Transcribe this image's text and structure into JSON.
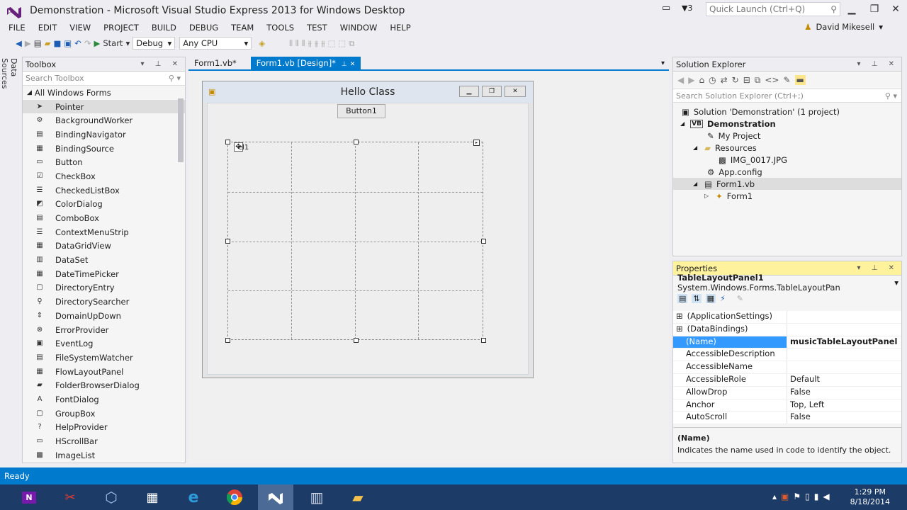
{
  "window": {
    "title": "Demonstration - Microsoft Visual Studio Express 2013 for Windows Desktop",
    "notif_count": "3",
    "quick_launch_placeholder": "Quick Launch (Ctrl+Q)"
  },
  "menu": [
    "FILE",
    "EDIT",
    "VIEW",
    "PROJECT",
    "BUILD",
    "DEBUG",
    "TEAM",
    "TOOLS",
    "TEST",
    "WINDOW",
    "HELP"
  ],
  "user": "David Mikesell",
  "toolbar": {
    "start": "Start",
    "config": "Debug",
    "platform": "Any CPU"
  },
  "side_tab": "Data Sources",
  "toolbox": {
    "title": "Toolbox",
    "search_placeholder": "Search Toolbox",
    "group": "All Windows Forms",
    "items": [
      "Pointer",
      "BackgroundWorker",
      "BindingNavigator",
      "BindingSource",
      "Button",
      "CheckBox",
      "CheckedListBox",
      "ColorDialog",
      "ComboBox",
      "ContextMenuStrip",
      "DataGridView",
      "DataSet",
      "DateTimePicker",
      "DirectoryEntry",
      "DirectorySearcher",
      "DomainUpDown",
      "ErrorProvider",
      "EventLog",
      "FileSystemWatcher",
      "FlowLayoutPanel",
      "FolderBrowserDialog",
      "FontDialog",
      "GroupBox",
      "HelpProvider",
      "HScrollBar",
      "ImageList"
    ]
  },
  "editor_tabs": [
    {
      "label": "Form1.vb*"
    },
    {
      "label": "Form1.vb [Design]*"
    }
  ],
  "form": {
    "title": "Hello Class",
    "button": "Button1",
    "label_partial": "el1"
  },
  "solution_explorer": {
    "title": "Solution Explorer",
    "search_placeholder": "Search Solution Explorer (Ctrl+;)",
    "nodes": [
      "Solution 'Demonstration' (1 project)",
      "Demonstration",
      "My Project",
      "Resources",
      "IMG_0017.JPG",
      "App.config",
      "Form1.vb",
      "Form1"
    ]
  },
  "properties": {
    "title": "Properties",
    "object_name": "TableLayoutPanel1",
    "object_type": "System.Windows.Forms.TableLayoutPan",
    "rows": [
      {
        "name": "(ApplicationSettings)",
        "value": ""
      },
      {
        "name": "(DataBindings)",
        "value": ""
      },
      {
        "name": "(Name)",
        "value": "musicTableLayoutPanel"
      },
      {
        "name": "AccessibleDescription",
        "value": ""
      },
      {
        "name": "AccessibleName",
        "value": ""
      },
      {
        "name": "AccessibleRole",
        "value": "Default"
      },
      {
        "name": "AllowDrop",
        "value": "False"
      },
      {
        "name": "Anchor",
        "value": "Top, Left"
      },
      {
        "name": "AutoScroll",
        "value": "False"
      }
    ],
    "desc_title": "(Name)",
    "desc_text": "Indicates the name used in code to identify the object."
  },
  "status": "Ready",
  "clock": {
    "time": "1:29 PM",
    "date": "8/18/2014"
  }
}
